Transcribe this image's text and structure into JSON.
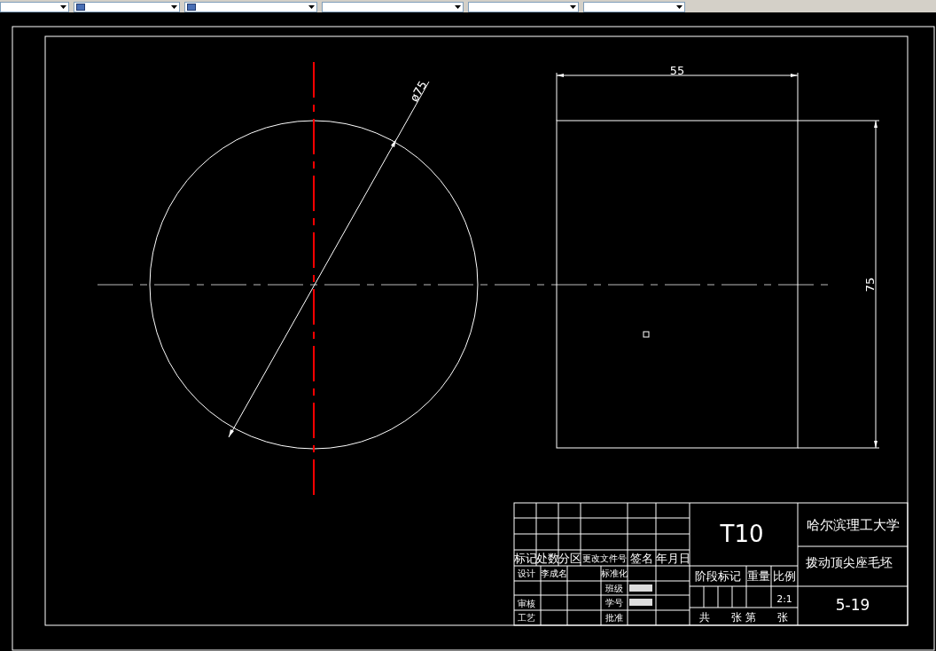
{
  "toolbar": {
    "dropdowns": [
      {
        "kind": "plain"
      },
      {
        "kind": "icon"
      },
      {
        "kind": "icon"
      },
      {
        "kind": "plain"
      },
      {
        "kind": "plain"
      },
      {
        "kind": "plain"
      }
    ]
  },
  "drawing": {
    "diameter_dimension": "ø75",
    "width_dimension": "55",
    "height_dimension": "75"
  },
  "title_block": {
    "revision_headers": [
      "标记",
      "处数",
      "分区",
      "更改文件号",
      "签名",
      "年月日"
    ],
    "sign_labels": [
      "设计",
      "审核",
      "工艺"
    ],
    "designer": "李成名",
    "approval_labels": [
      "标准化",
      "班级",
      "学号",
      "批准"
    ],
    "drawing_code": "T10",
    "stage_headers": [
      "阶段标记",
      "重量",
      "比例"
    ],
    "scale": "2:1",
    "sheet_text": "共　　张 第　　张",
    "school": "哈尔滨理工大学",
    "part_name": "拨动顶尖座毛坯",
    "number": "5-19"
  }
}
